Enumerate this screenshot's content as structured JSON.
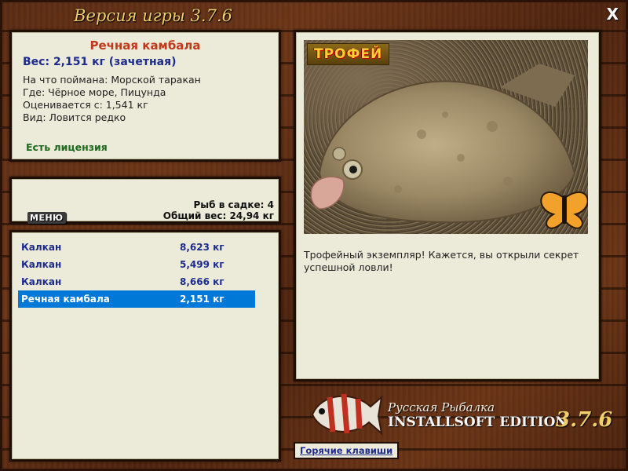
{
  "window": {
    "title": "Версия игры 3.7.6",
    "close_label": "X"
  },
  "fish_info": {
    "name": "Речная камбала",
    "weight": "Вес: 2,151 кг (зачетная)",
    "lines": [
      "На что поймана: Морской таракан",
      "Где: Чёрное море, Пицунда",
      "Оценивается с: 1,541 кг",
      "Вид: Ловится редко"
    ],
    "license": "Есть лицензия"
  },
  "summary": {
    "menu_label": "МЕНЮ",
    "fish_count": "Рыб в садке: 4",
    "total_weight": "Общий вес: 24,94 кг"
  },
  "catch_list": [
    {
      "name": "Калкан",
      "weight": "8,623 кг",
      "selected": false
    },
    {
      "name": "Калкан",
      "weight": "5,499 кг",
      "selected": false
    },
    {
      "name": "Калкан",
      "weight": "8,666 кг",
      "selected": false
    },
    {
      "name": "Речная камбала",
      "weight": "2,151 кг",
      "selected": true
    }
  ],
  "detail": {
    "badge": "ТРОФЕЙ",
    "text": "Трофейный экземпляр! Кажется, вы открыли секрет успешной ловли!"
  },
  "brand": {
    "line1": "Русская Рыбалка",
    "line2": "INSTALLSOFT EDITION",
    "version": "3.7.6"
  },
  "hotkeys_label": "Горячие клавиши",
  "colors": {
    "accent_red": "#c0391b",
    "accent_blue": "#1d2b8c",
    "license_green": "#1c6b1c",
    "selection": "#0078d7",
    "title_gold": "#f0cf6a"
  }
}
